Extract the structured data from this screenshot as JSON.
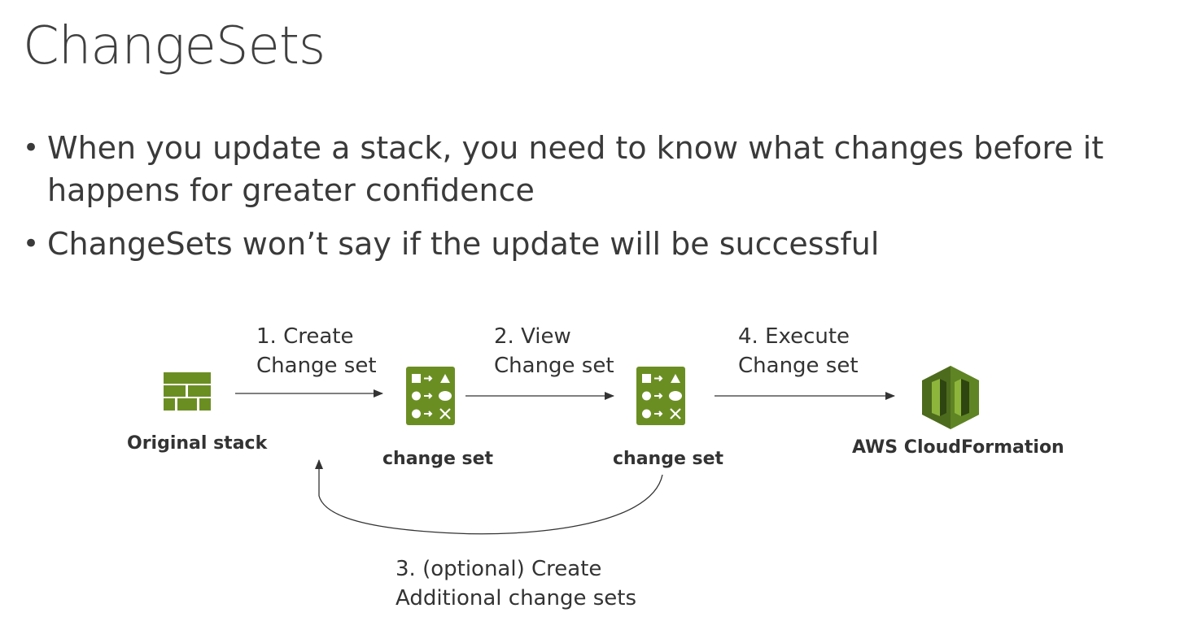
{
  "title": "ChangeSets",
  "bullets": [
    {
      "text": "When you update a stack, you need to know what changes before it happens for greater confidence"
    },
    {
      "text": "ChangeSets won’t say if the update will be successful"
    }
  ],
  "diagram": {
    "nodes": {
      "original_stack": {
        "label": "Original stack",
        "icon": "brick-wall-icon"
      },
      "change_set_1": {
        "label": "change set",
        "icon": "change-set-icon"
      },
      "change_set_2": {
        "label": "change set",
        "icon": "change-set-icon"
      },
      "cloudformation": {
        "label": "AWS CloudFormation",
        "icon": "cloudformation-icon"
      }
    },
    "steps": {
      "create": {
        "line1": "1.   Create",
        "line2": "Change set"
      },
      "view": {
        "line1": "2. View",
        "line2": "Change set"
      },
      "execute": {
        "line1": "4. Execute",
        "line2": "Change set"
      },
      "optional": {
        "line1": "3. (optional) Create",
        "line2": "Additional change sets"
      }
    },
    "colors": {
      "icon_green": "#6b8e23",
      "icon_green_dark": "#4d6b1c",
      "icon_green_light": "#8db53c",
      "arrow": "#333333"
    }
  }
}
